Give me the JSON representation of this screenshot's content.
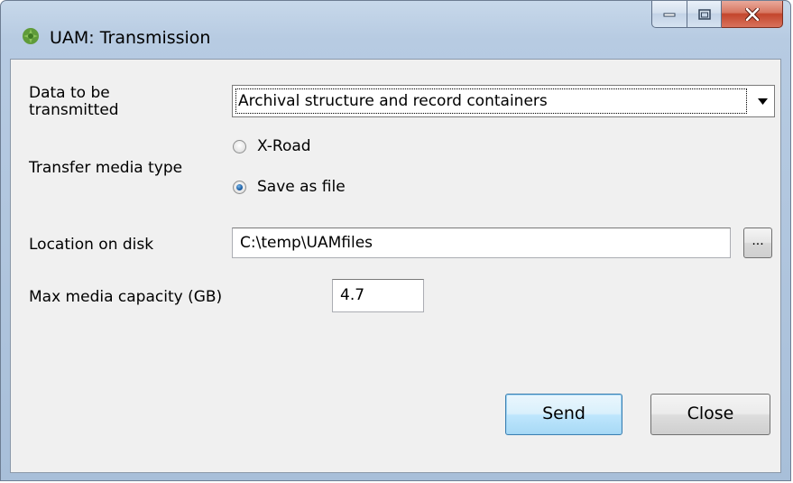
{
  "window": {
    "title": "UAM: Transmission",
    "icon": "leaf-app-icon",
    "controls": [
      "minimize-icon",
      "maximize-icon",
      "close-icon"
    ]
  },
  "form": {
    "data_label": "Data to be transmitted",
    "data_value": "Archival structure and record containers",
    "transfer_label": "Transfer media type",
    "radio_options": [
      {
        "label": "X-Road",
        "selected": false
      },
      {
        "label": "Save as file",
        "selected": true
      }
    ],
    "location_label": "Location on disk",
    "location_value": "C:\\temp\\UAMfiles",
    "browse_label": "...",
    "capacity_label": "Max media capacity (GB)",
    "capacity_value": "4.7"
  },
  "buttons": {
    "send": "Send",
    "close": "Close"
  },
  "colors": {
    "frame": "#b7cbe2",
    "close_red": "#c3452c",
    "default_button": "#bee6fd"
  }
}
